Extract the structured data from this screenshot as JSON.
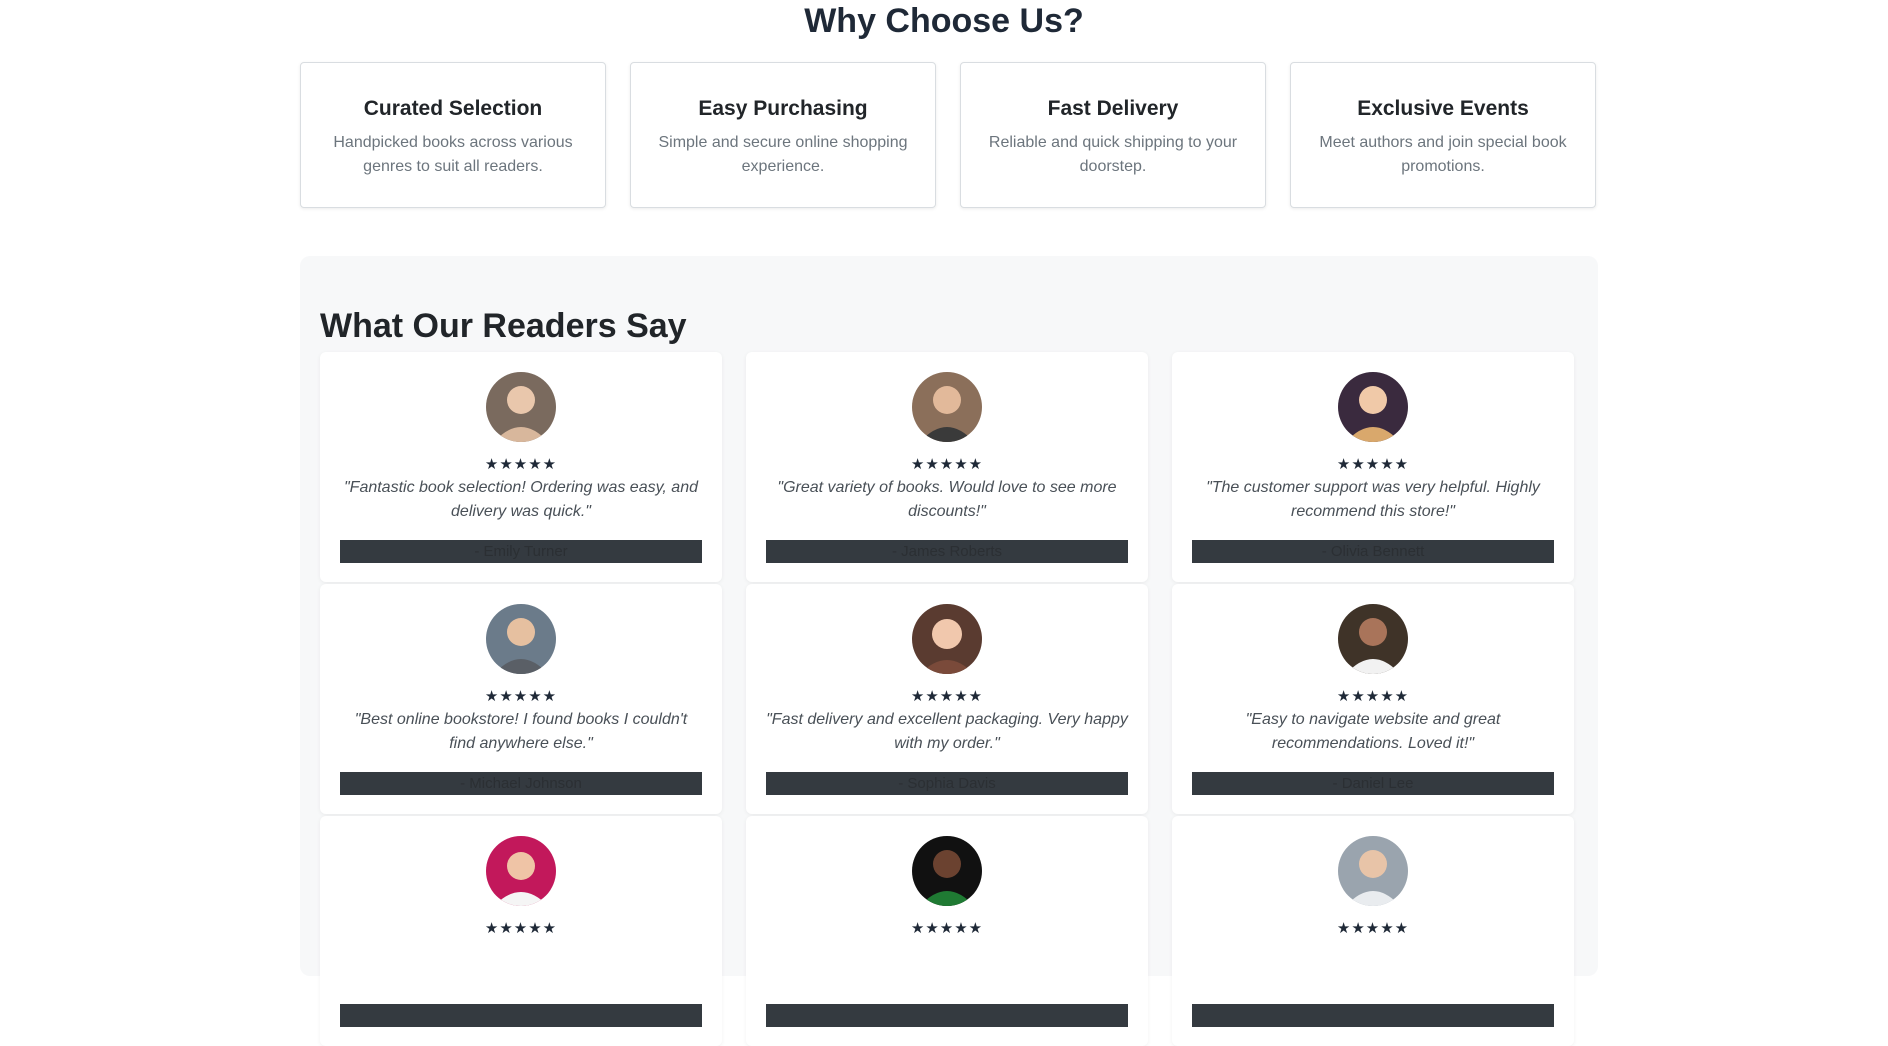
{
  "why": {
    "title": "Why Choose Us?",
    "features": [
      {
        "title": "Curated Selection",
        "desc": "Handpicked books across various genres to suit all readers."
      },
      {
        "title": "Easy Purchasing",
        "desc": "Simple and secure online shopping experience."
      },
      {
        "title": "Fast Delivery",
        "desc": "Reliable and quick shipping to your doorstep."
      },
      {
        "title": "Exclusive Events",
        "desc": "Meet authors and join special book promotions."
      }
    ]
  },
  "testimonials": {
    "title": "What Our Readers Say",
    "items": [
      {
        "stars": "★★★★★",
        "quote": "\"Fantastic book selection! Ordering was easy, and delivery was quick.\"",
        "author": "- Emily Turner",
        "avatar_color": "#7a6a5e"
      },
      {
        "stars": "★★★★★",
        "quote": "\"Great variety of books. Would love to see more discounts!\"",
        "author": "- James Roberts",
        "avatar_color": "#8b6f5a"
      },
      {
        "stars": "★★★★★",
        "quote": "\"The customer support was very helpful. Highly recommend this store!\"",
        "author": "- Olivia Bennett",
        "avatar_color": "#3a2a3e"
      },
      {
        "stars": "★★★★★",
        "quote": "\"Best online bookstore! I found books I couldn't find anywhere else.\"",
        "author": "- Michael Johnson",
        "avatar_color": "#6b7b8a"
      },
      {
        "stars": "★★★★★",
        "quote": "\"Fast delivery and excellent packaging. Very happy with my order.\"",
        "author": "- Sophia Davis",
        "avatar_color": "#5a3b30"
      },
      {
        "stars": "★★★★★",
        "quote": "\"Easy to navigate website and great recommendations. Loved it!\"",
        "author": "- Daniel Lee",
        "avatar_color": "#3f3328"
      },
      {
        "stars": "★★★★★",
        "quote": "",
        "author": "",
        "avatar_color": "#c2185b"
      },
      {
        "stars": "★★★★★",
        "quote": "",
        "author": "",
        "avatar_color": "#1f7a33"
      },
      {
        "stars": "★★★★★",
        "quote": "",
        "author": "",
        "avatar_color": "#9aa4ae"
      }
    ]
  }
}
